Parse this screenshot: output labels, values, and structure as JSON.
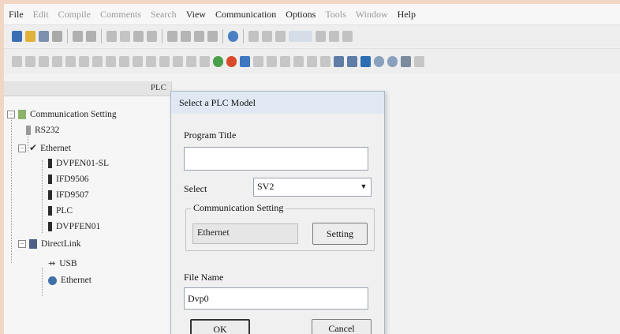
{
  "menu": {
    "items": [
      {
        "label": "File",
        "dim": false
      },
      {
        "label": "Edit",
        "dim": true
      },
      {
        "label": "Compile",
        "dim": true
      },
      {
        "label": "Comments",
        "dim": true
      },
      {
        "label": "Search",
        "dim": true
      },
      {
        "label": "View",
        "dim": false
      },
      {
        "label": "Communication",
        "dim": false
      },
      {
        "label": "Options",
        "dim": false
      },
      {
        "label": "Tools",
        "dim": true
      },
      {
        "label": "Window",
        "dim": true
      },
      {
        "label": "Help",
        "dim": false
      }
    ]
  },
  "tree": {
    "header_label": "PLC",
    "root": "Communication Setting",
    "rs232": "RS232",
    "ethernet": "Ethernet",
    "ethernet_children": [
      "DVPEN01-SL",
      "IFD9506",
      "IFD9507",
      "PLC",
      "DVPFEN01"
    ],
    "direct_link": "DirectLink",
    "direct_children": [
      "USB",
      "Ethernet"
    ]
  },
  "dialog": {
    "title": "Select a PLC Model",
    "program_title_label": "Program Title",
    "program_title_value": "",
    "select_label": "Select",
    "select_value": "SV2",
    "comm_group_label": "Communication Setting",
    "comm_value": "Ethernet",
    "setting_button": "Setting",
    "file_name_label": "File Name",
    "file_name_value": "Dvp0",
    "ok_button": "OK",
    "cancel_button": "Cancel"
  },
  "colors": {
    "border_frame": "#f1d6c6",
    "dialog_title_bg": "#dfe8f3",
    "toolbar_bg": "#eeeeee"
  }
}
